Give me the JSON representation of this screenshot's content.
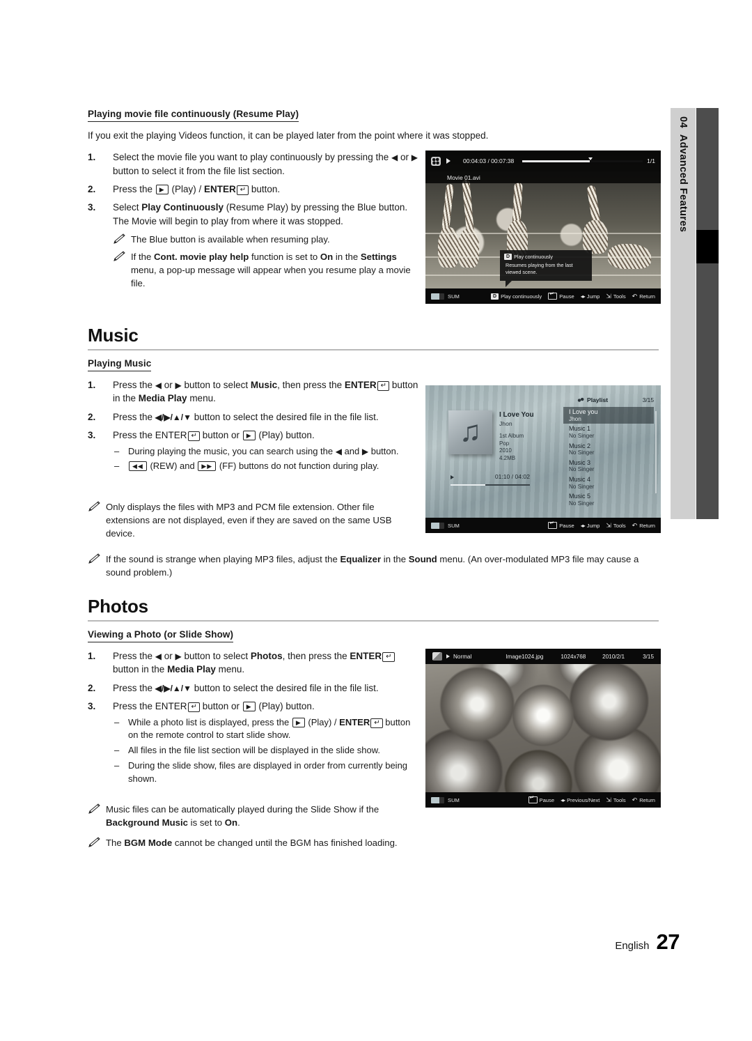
{
  "chapter_tab": {
    "number": "04",
    "label": "Advanced Features"
  },
  "resume_play": {
    "heading": "Playing movie file continuously (Resume Play)",
    "lead": "If you exit the playing Videos function, it can be played later from the point where it was stopped.",
    "steps": [
      {
        "num": "1.",
        "text_a": "Select the movie file you want to play continuously by pressing the ",
        "arrow_left": "◀",
        "text_b": " or ",
        "arrow_right": "▶",
        "text_c": " button to select it from the file list section."
      },
      {
        "num": "2.",
        "text_a": "Press the ",
        "play_key": "▶",
        "text_b": " (Play) / ",
        "enter_label": "ENTER",
        "text_c": " button."
      },
      {
        "num": "3.",
        "text_a": "Select ",
        "bold_a": "Play Continuously",
        "text_b": " (Resume Play) by pressing the Blue button. The Movie will begin to play from where it was stopped."
      }
    ],
    "notes": [
      {
        "text": "The Blue button is available when resuming play."
      },
      {
        "text_a": "If the ",
        "bold_a": "Cont. movie play help",
        "text_b": " function is set to ",
        "bold_b": "On",
        "text_c": " in the ",
        "bold_c": "Settings",
        "text_d": " menu, a pop-up message will appear when you resume play a movie file."
      }
    ]
  },
  "music_section": {
    "title": "Music",
    "sub_heading": "Playing Music",
    "steps": [
      {
        "num": "1.",
        "text_a": "Press the ",
        "arrow_left": "◀",
        "text_b": " or ",
        "arrow_right": "▶",
        "text_c": " button to select ",
        "bold_a": "Music",
        "text_d": ", then press the ",
        "enter_label": "ENTER",
        "text_e": " button in the ",
        "bold_b": "Media Play",
        "text_f": " menu."
      },
      {
        "num": "2.",
        "text_a": "Press the ",
        "arrows": "◀/▶/▲/▼",
        "text_b": " button to select the desired file in the file list."
      },
      {
        "num": "3.",
        "text_a": "Press the ",
        "enter_label": "ENTER",
        "text_b": " button or ",
        "play_key": "▶",
        "text_c": " (Play) button."
      }
    ],
    "dashes": [
      {
        "text_a": "During playing the music, you can search using the ",
        "arrow_left": "◀",
        "text_b": " and ",
        "arrow_right": "▶",
        "text_c": " button."
      },
      {
        "rew_key": "◀◀",
        "text_a": " (REW) and ",
        "ff_key": "▶▶",
        "text_b": " (FF) buttons do not function during play."
      }
    ],
    "notes": [
      {
        "text": "Only displays the files with MP3 and PCM file extension. Other file extensions are not displayed, even if they are saved on the same USB device."
      },
      {
        "text_a": "If the sound is strange when playing MP3 files, adjust the ",
        "bold_a": "Equalizer",
        "text_b": " in the ",
        "bold_b": "Sound",
        "text_c": " menu. (An over-modulated MP3 file may cause a sound problem.)"
      }
    ]
  },
  "photos_section": {
    "title": "Photos",
    "sub_heading": "Viewing a Photo (or Slide Show)",
    "steps": [
      {
        "num": "1.",
        "text_a": "Press the ",
        "arrow_left": "◀",
        "text_b": " or ",
        "arrow_right": "▶",
        "text_c": " button to select ",
        "bold_a": "Photos",
        "text_d": ", then press the ",
        "enter_label": "ENTER",
        "text_e": " button in the ",
        "bold_b": "Media Play",
        "text_f": " menu."
      },
      {
        "num": "2.",
        "text_a": "Press the ",
        "arrows": "◀/▶/▲/▼",
        "text_b": " button to select the desired file in the file list."
      },
      {
        "num": "3.",
        "text_a": "Press the ",
        "enter_label": "ENTER",
        "text_b": " button or ",
        "play_key": "▶",
        "text_c": " (Play) button."
      }
    ],
    "dashes": [
      {
        "text_a": "While a photo list is displayed, press the ",
        "play_key": "▶",
        "text_b": " (Play) / ",
        "enter_label": "ENTER",
        "text_c": " button on the remote control to start slide show."
      },
      {
        "text_a": "All files in the file list section will be displayed in the slide show."
      },
      {
        "text_a": "During the slide show, files are displayed in order from currently being shown."
      }
    ],
    "notes": [
      {
        "text_a": "Music files can be automatically played during the Slide Show if the ",
        "bold_a": "Background Music",
        "text_b": " is set to ",
        "bold_b": "On",
        "text_c": "."
      },
      {
        "text_a": "The ",
        "bold_a": "BGM Mode",
        "text_b": " cannot be changed until the BGM has finished loading."
      }
    ]
  },
  "video_screenshot": {
    "time": "00:04:03 / 00:07:38",
    "count": "1/1",
    "filename": "Movie 01.avi",
    "tooltip": {
      "button": "D",
      "title": "Play continuously",
      "body": "Resumes playing from the last viewed scene."
    },
    "bottom_bar": {
      "source": "SUM",
      "items": [
        {
          "key": "D",
          "label": "Play continuously"
        },
        {
          "key": "enter",
          "label": "Pause"
        },
        {
          "key": "leftright",
          "label": "Jump"
        },
        {
          "key": "tools",
          "label": "Tools"
        },
        {
          "key": "return",
          "label": "Return"
        }
      ]
    }
  },
  "music_screenshot": {
    "track_title": "I Love You",
    "track_artist": "Jhon",
    "meta_album": "1st Album",
    "meta_genre": "Pop",
    "meta_year": "2010",
    "meta_size": "4.2MB",
    "elapsed_total": "01:10 / 04:02",
    "playlist_label": "Playlist",
    "playlist_count": "3/15",
    "playlist": [
      {
        "title": "I Love you",
        "singer": "Jhon",
        "selected": true
      },
      {
        "title": "Music 1",
        "singer": "No Singer",
        "selected": false
      },
      {
        "title": "Music 2",
        "singer": "No Singer",
        "selected": false
      },
      {
        "title": "Music 3",
        "singer": "No Singer",
        "selected": false
      },
      {
        "title": "Music 4",
        "singer": "No Singer",
        "selected": false
      },
      {
        "title": "Music 5",
        "singer": "No Singer",
        "selected": false
      }
    ],
    "bottom_bar": {
      "source": "SUM",
      "items": [
        {
          "key": "enter",
          "label": "Pause"
        },
        {
          "key": "leftright",
          "label": "Jump"
        },
        {
          "key": "tools",
          "label": "Tools"
        },
        {
          "key": "return",
          "label": "Return"
        }
      ]
    }
  },
  "photo_screenshot": {
    "mode": "Normal",
    "filename": "Image1024.jpg",
    "resolution": "1024x768",
    "date": "2010/2/1",
    "count": "3/15",
    "bottom_bar": {
      "source": "SUM",
      "items": [
        {
          "key": "enter",
          "label": "Pause"
        },
        {
          "key": "leftright",
          "label": "Previous/Next"
        },
        {
          "key": "tools",
          "label": "Tools"
        },
        {
          "key": "return",
          "label": "Return"
        }
      ]
    }
  },
  "footer": {
    "language": "English",
    "page_number": "27"
  }
}
